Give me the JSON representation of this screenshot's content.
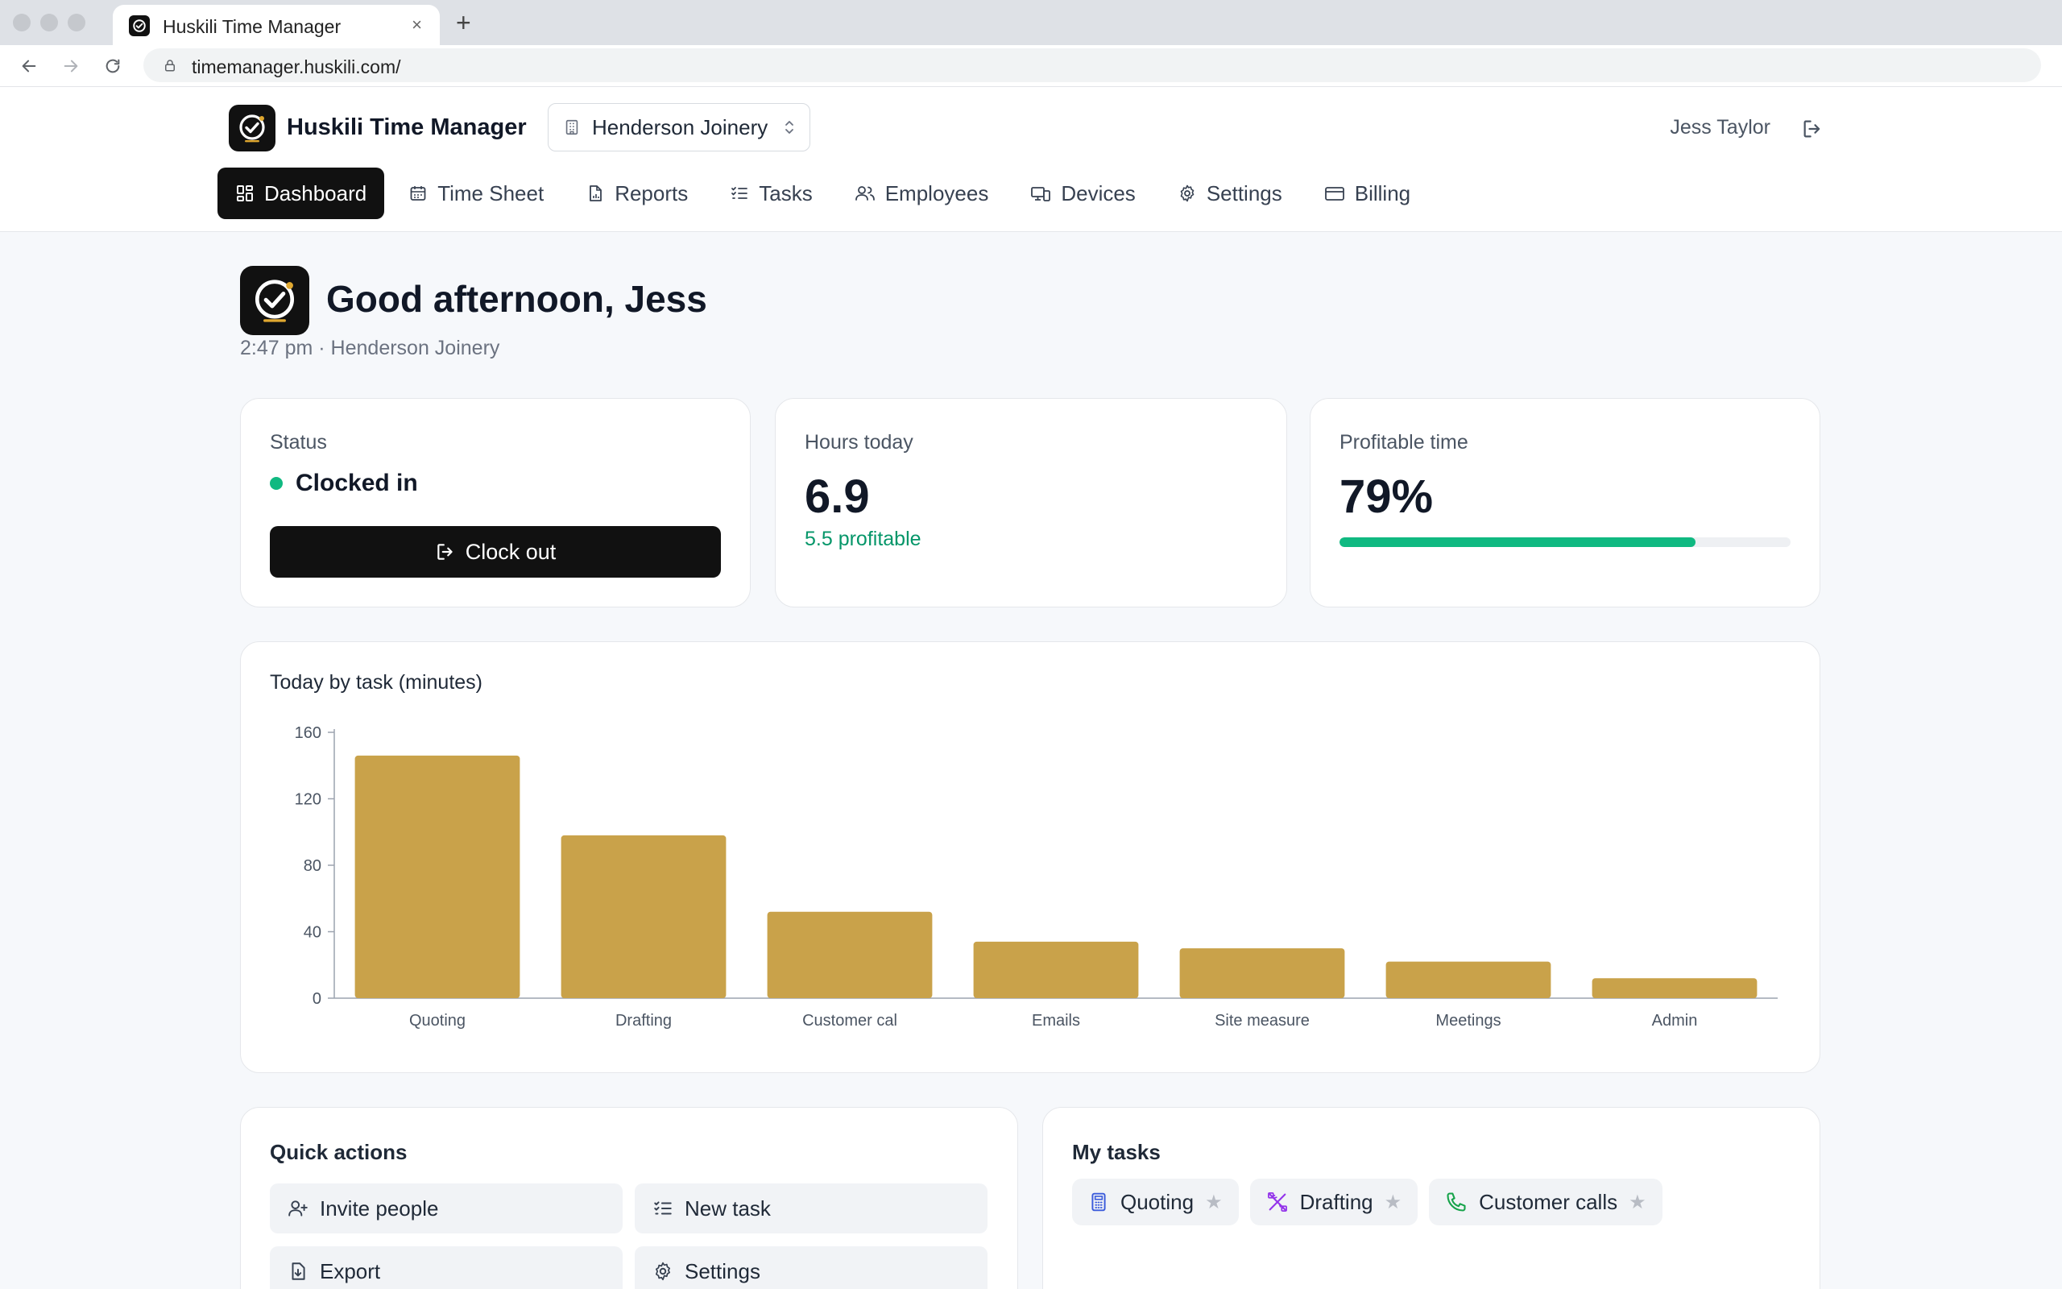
{
  "browser": {
    "tab_title": "Huskili Time Manager",
    "tab_close": "×",
    "new_tab": "+",
    "url": "timemanager.huskili.com/"
  },
  "header": {
    "app_name": "Huskili Time Manager",
    "org": "Henderson Joinery",
    "user": "Jess Taylor",
    "nav": [
      {
        "label": "Dashboard",
        "icon": "dashboard-icon",
        "active": true
      },
      {
        "label": "Time Sheet",
        "icon": "calendar-icon"
      },
      {
        "label": "Reports",
        "icon": "report-icon"
      },
      {
        "label": "Tasks",
        "icon": "checklist-icon"
      },
      {
        "label": "Employees",
        "icon": "users-icon"
      },
      {
        "label": "Devices",
        "icon": "devices-icon"
      },
      {
        "label": "Settings",
        "icon": "gear-icon"
      },
      {
        "label": "Billing",
        "icon": "card-icon"
      }
    ]
  },
  "greeting": {
    "title": "Good afternoon, Jess",
    "subtitle": "2:47 pm · Henderson Joinery"
  },
  "status_card": {
    "label": "Status",
    "status": "Clocked in",
    "status_color": "#10b981",
    "button": "Clock out"
  },
  "hours_card": {
    "label": "Hours today",
    "value": "6.9",
    "sub": "5.5 profitable"
  },
  "profit_card": {
    "label": "Profitable time",
    "value": "79%",
    "progress": 0.79
  },
  "chart_data": {
    "type": "bar",
    "title": "Today by task (minutes)",
    "categories": [
      "Quoting",
      "Drafting",
      "Customer cal",
      "Emails",
      "Site measure",
      "Meetings",
      "Admin"
    ],
    "values": [
      146,
      98,
      52,
      34,
      30,
      22,
      12
    ],
    "ylim": [
      0,
      160
    ],
    "yticks": [
      0,
      40,
      80,
      120,
      160
    ],
    "color": "#c9a24a",
    "grid": false
  },
  "quick_actions": {
    "title": "Quick actions",
    "items": [
      {
        "label": "Invite people",
        "icon": "add-user-icon"
      },
      {
        "label": "New task",
        "icon": "checklist-icon"
      },
      {
        "label": "Export",
        "icon": "export-icon"
      },
      {
        "label": "Settings",
        "icon": "gear-icon"
      }
    ]
  },
  "my_tasks": {
    "title": "My tasks",
    "items": [
      {
        "label": "Quoting",
        "icon": "calculator-icon",
        "icon_color": "#3b5bdb"
      },
      {
        "label": "Drafting",
        "icon": "drafting-icon",
        "icon_color": "#9333ea"
      },
      {
        "label": "Customer calls",
        "icon": "phone-icon",
        "icon_color": "#16a34a"
      }
    ]
  },
  "colors": {
    "accent_dark": "#111111",
    "success": "#10b981",
    "logo_accent": "#e0a830"
  }
}
